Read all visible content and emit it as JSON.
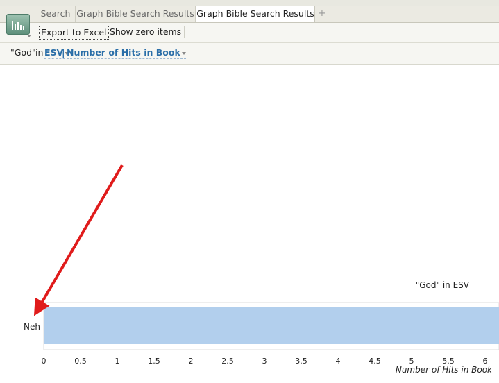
{
  "tabs": [
    {
      "label": "Search",
      "active": false
    },
    {
      "label": "Graph Bible Search Results",
      "active": false
    },
    {
      "label": "Graph Bible Search Results",
      "active": true
    }
  ],
  "tab_add_label": "+",
  "toolbar": {
    "app_icon": "bar-chart-icon",
    "export_label": "Export to Excel",
    "zero_label": "Show zero items"
  },
  "query": {
    "term": "\"God\"",
    "in_word": "in",
    "version": "ESV",
    "divider": "|",
    "measure": "Number of Hits in Book"
  },
  "colors": {
    "bar": "#b2cfed",
    "arrow": "#e01b1b",
    "link": "#2a6ea8"
  },
  "chart_data": {
    "type": "bar",
    "orientation": "horizontal",
    "categories": [
      "Neh"
    ],
    "series": [
      {
        "name": "\"God\" in ESV",
        "values": [
          6.2
        ]
      }
    ],
    "xlabel": "Number of Hits in Book",
    "xlim": [
      0,
      6.2
    ],
    "xticks": [
      "0",
      "0.5",
      "1",
      "1.5",
      "2",
      "2.5",
      "3",
      "3.5",
      "4",
      "4.5",
      "5",
      "5.5",
      "6"
    ],
    "grid": true,
    "legend_position": "top-right"
  }
}
